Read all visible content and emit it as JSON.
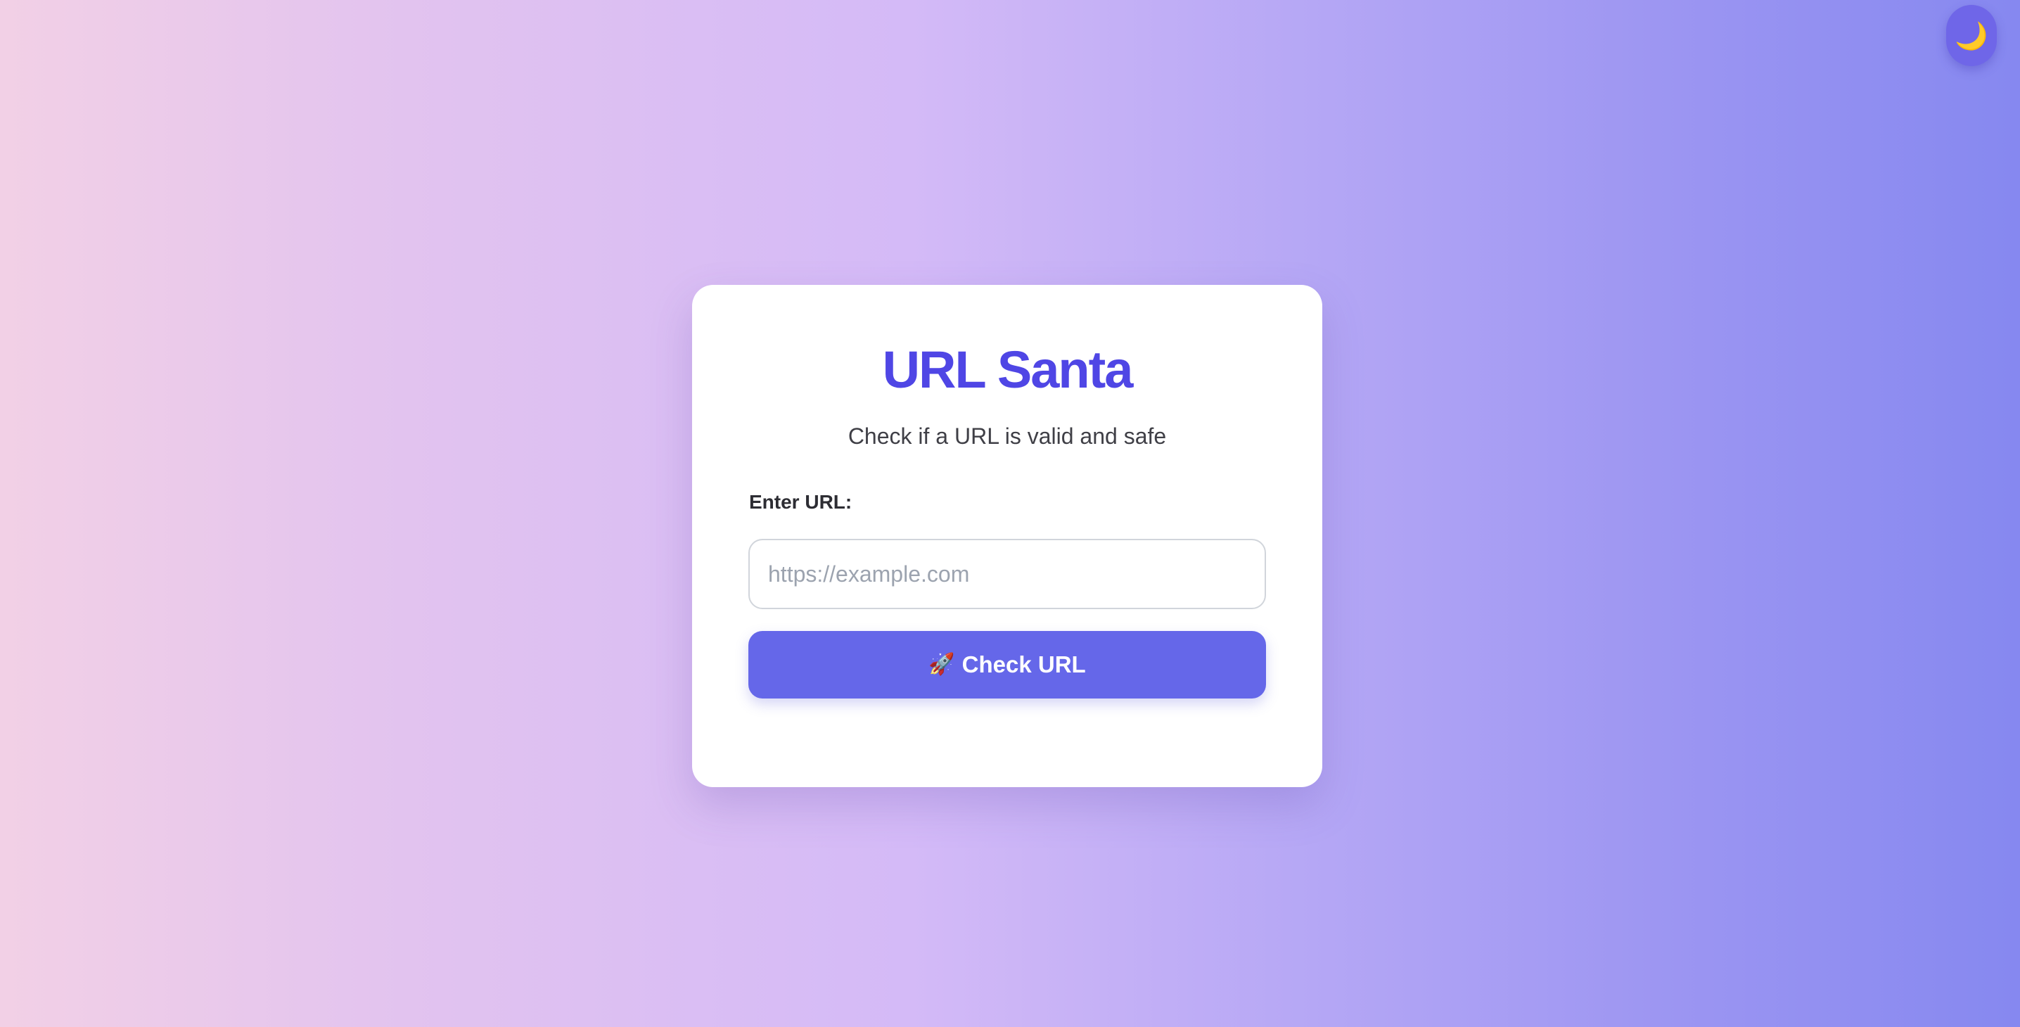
{
  "theme_toggle": {
    "icon": "moon-icon",
    "glyph": "🌙"
  },
  "card": {
    "title": "URL Santa",
    "subtitle": "Check if a URL is valid and safe",
    "field_label": "Enter URL:",
    "url_input": {
      "value": "",
      "placeholder": "https://example.com"
    },
    "check_button": {
      "icon": "rocket-icon",
      "glyph": "🚀",
      "label": "Check URL"
    }
  },
  "colors": {
    "accent": "#4f46e5",
    "button": "#6567e9",
    "toggle": "#6f66e8",
    "gradient_start": "#f2d0e6",
    "gradient_end": "#8688f0"
  }
}
